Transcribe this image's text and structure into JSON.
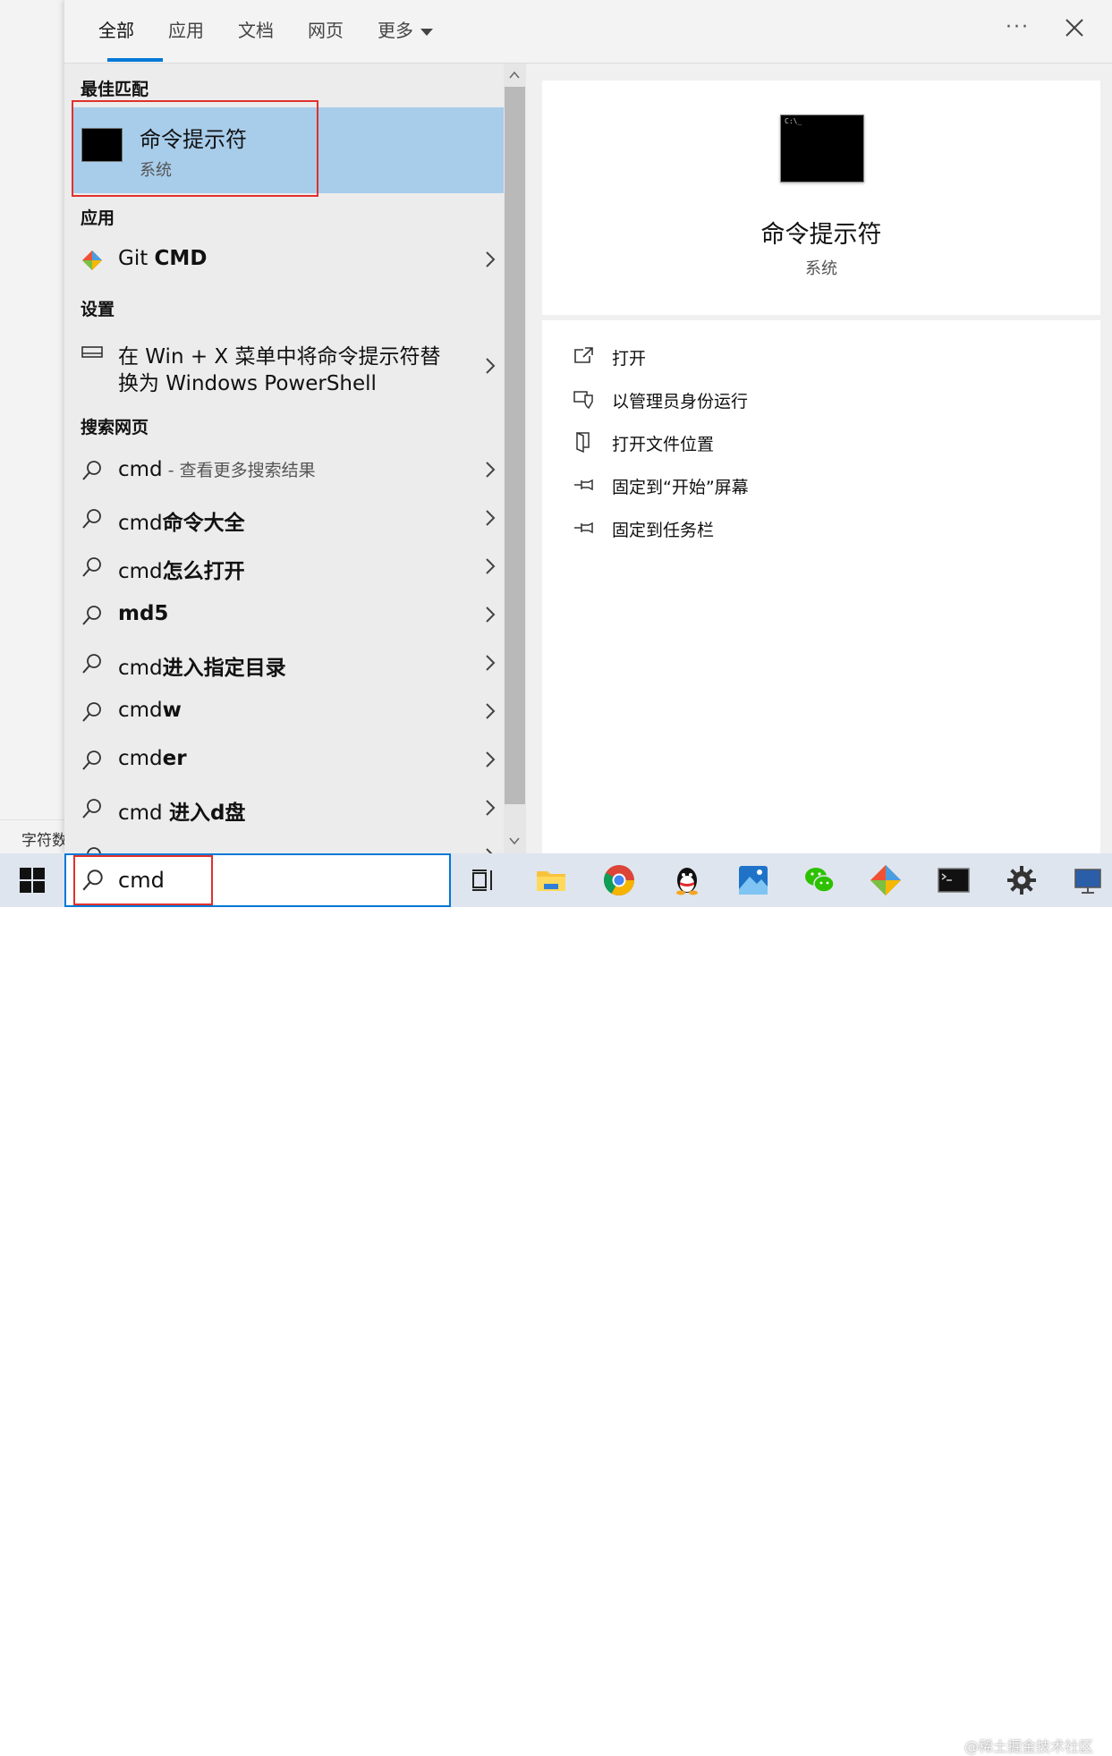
{
  "background_window": {
    "text": "字符数"
  },
  "tabs": [
    {
      "label": "全部"
    },
    {
      "label": "应用"
    },
    {
      "label": "文档"
    },
    {
      "label": "网页"
    },
    {
      "label": "更多"
    }
  ],
  "sections": {
    "best_match": "最佳匹配",
    "apps": "应用",
    "settings": "设置",
    "web": "搜索网页"
  },
  "best_match": {
    "title": "命令提示符",
    "subtitle": "系统"
  },
  "apps": [
    {
      "pre": "Git ",
      "bold": "CMD"
    }
  ],
  "settings": [
    {
      "line1": "在 Win + X 菜单中将命令提示符替",
      "line2": "换为 Windows PowerShell"
    }
  ],
  "web_results": [
    {
      "pre": "cmd",
      "bold": "",
      "suffix": " - 查看更多搜索结果"
    },
    {
      "pre": "cmd",
      "bold": "命令大全",
      "suffix": ""
    },
    {
      "pre": "cmd",
      "bold": "怎么打开",
      "suffix": ""
    },
    {
      "pre": "",
      "bold": "md5",
      "suffix": ""
    },
    {
      "pre": "cmd",
      "bold": "进入指定目录",
      "suffix": ""
    },
    {
      "pre": "cmd",
      "bold": "w",
      "suffix": ""
    },
    {
      "pre": "cmd",
      "bold": "er",
      "suffix": ""
    },
    {
      "pre": "cmd ",
      "bold": "进入d盘",
      "suffix": ""
    }
  ],
  "preview": {
    "title": "命令提示符",
    "subtitle": "系统",
    "icon_text": "C:\\_"
  },
  "actions": [
    {
      "label": "打开",
      "icon": "open-icon"
    },
    {
      "label": "以管理员身份运行",
      "icon": "shield-icon"
    },
    {
      "label": "打开文件位置",
      "icon": "file-location-icon"
    },
    {
      "label": "固定到“开始”屏幕",
      "icon": "pin-icon"
    },
    {
      "label": "固定到任务栏",
      "icon": "pin-icon"
    }
  ],
  "search": {
    "value": "cmd"
  },
  "taskbar_apps": [
    "task-view",
    "file-explorer",
    "chrome",
    "qq",
    "photos",
    "wechat",
    "git",
    "cmd",
    "settings",
    "remote-desktop"
  ],
  "watermark": "@稀土掘金技术社区",
  "colors": {
    "accent": "#0078d7",
    "selection": "#a8cdeb",
    "highlight_box": "#e0312d"
  }
}
